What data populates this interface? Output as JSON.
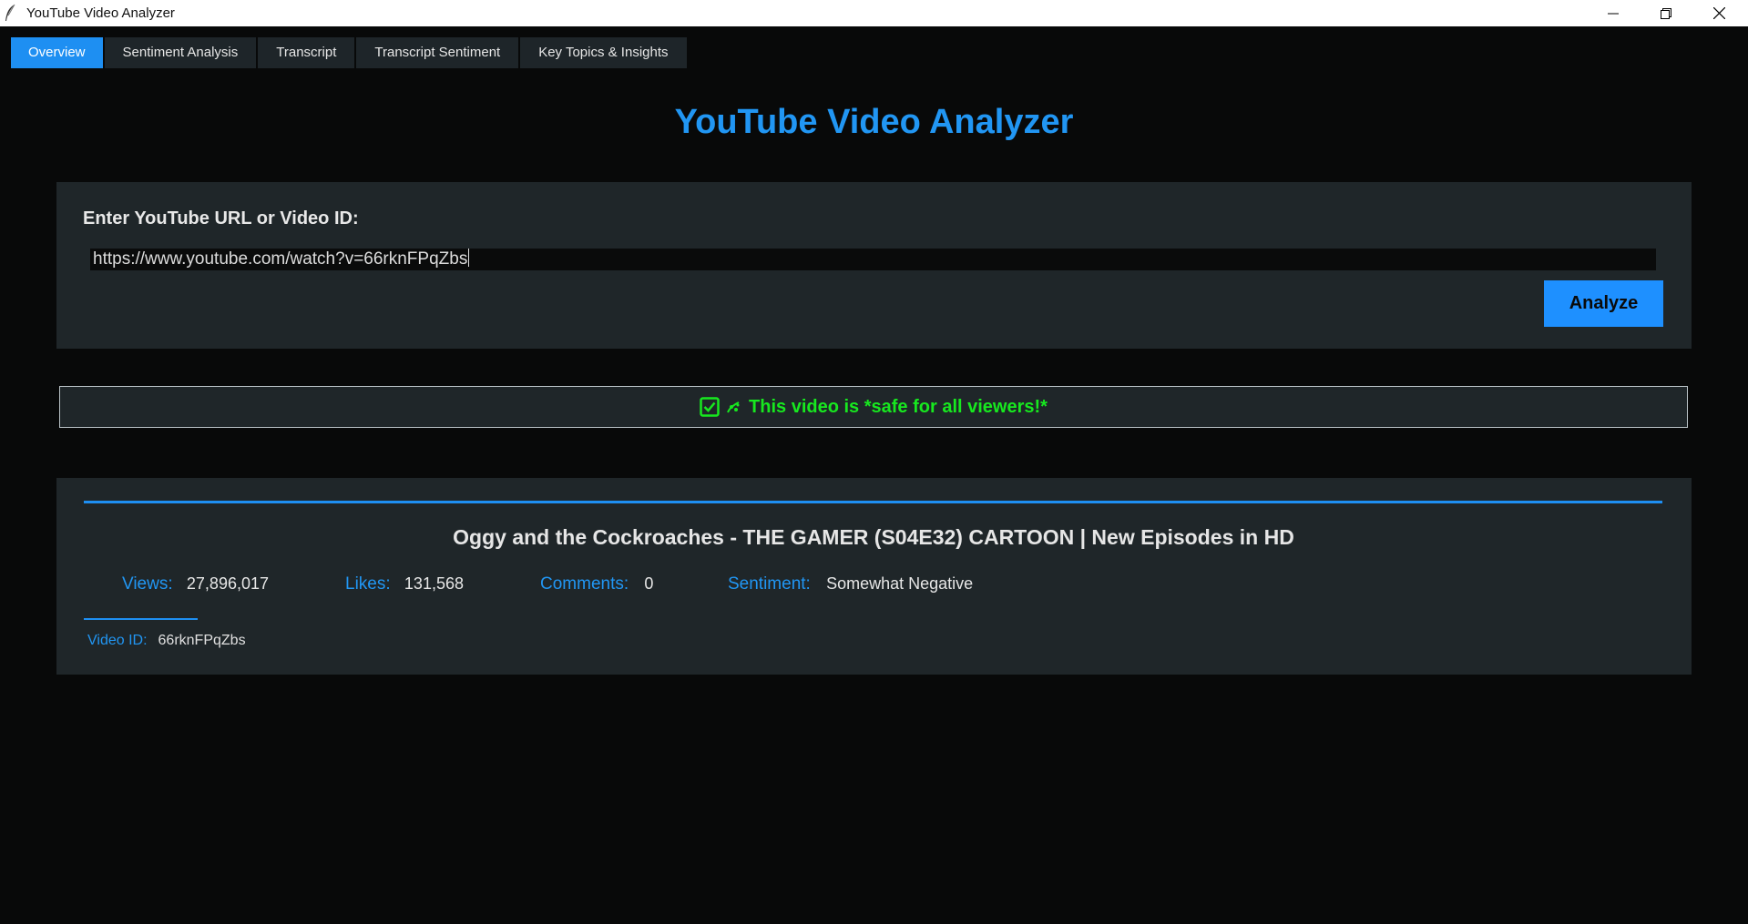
{
  "window": {
    "title": "YouTube Video Analyzer"
  },
  "tabs": [
    {
      "label": "Overview",
      "active": true
    },
    {
      "label": "Sentiment Analysis",
      "active": false
    },
    {
      "label": "Transcript",
      "active": false
    },
    {
      "label": "Transcript Sentiment",
      "active": false
    },
    {
      "label": "Key Topics & Insights",
      "active": false
    }
  ],
  "heading": "YouTube Video Analyzer",
  "input_section": {
    "label": "Enter YouTube URL or Video ID:",
    "url_value": "https://www.youtube.com/watch?v=66rknFPqZbs",
    "analyze_label": "Analyze"
  },
  "safety": {
    "message": "This video is *safe for all viewers!*",
    "icons": [
      "check-box-icon",
      "sparkle-icon"
    ]
  },
  "video": {
    "title": "Oggy and the Cockroaches - THE GAMER (S04E32) CARTOON | New Episodes in HD",
    "stats": {
      "views_label": "Views:",
      "views_value": "27,896,017",
      "likes_label": "Likes:",
      "likes_value": "131,568",
      "comments_label": "Comments:",
      "comments_value": "0",
      "sentiment_label": "Sentiment:",
      "sentiment_value": "Somewhat Negative"
    },
    "id_label": "Video ID:",
    "id_value": "66rknFPqZbs"
  },
  "colors": {
    "accent": "#1e8ff2",
    "safe_green": "#17e81f",
    "panel": "#1f2629",
    "background": "#080909"
  }
}
